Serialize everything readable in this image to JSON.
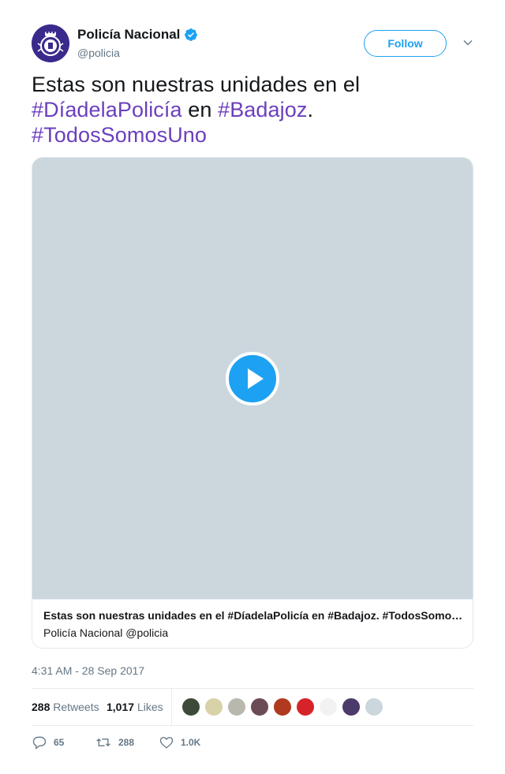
{
  "author": {
    "display_name": "Policía Nacional",
    "handle": "@policia",
    "verified": true,
    "avatar_icon": "police-crest-icon",
    "brand_color": "#3b2a8c"
  },
  "header": {
    "follow_label": "Follow"
  },
  "tweet": {
    "text_before": "Estas son nuestras unidades en el",
    "hashtag_1": "#DíadelaPolicía",
    "text_middle": "en",
    "hashtag_2": "#Badajoz",
    "punct": ".",
    "hashtag_3": "#TodosSomosUno",
    "hashtag_color": "#6b3fbd"
  },
  "media": {
    "background_color": "#ccd6dd",
    "play_icon": "play-icon",
    "card_title": "Estas son nuestras unidades en el #DíadelaPolicía en #Badajoz. #TodosSomosUno",
    "card_subtitle": "Policía Nacional @policia"
  },
  "timestamp": "4:31 AM - 28 Sep 2017",
  "stats": {
    "retweets_count": "288",
    "retweets_label": "Retweets",
    "likes_count": "1,017",
    "likes_label": "Likes"
  },
  "actions": {
    "reply_count": "65",
    "retweet_count": "288",
    "like_count": "1.0K"
  },
  "accent_color": "#1da1f2"
}
